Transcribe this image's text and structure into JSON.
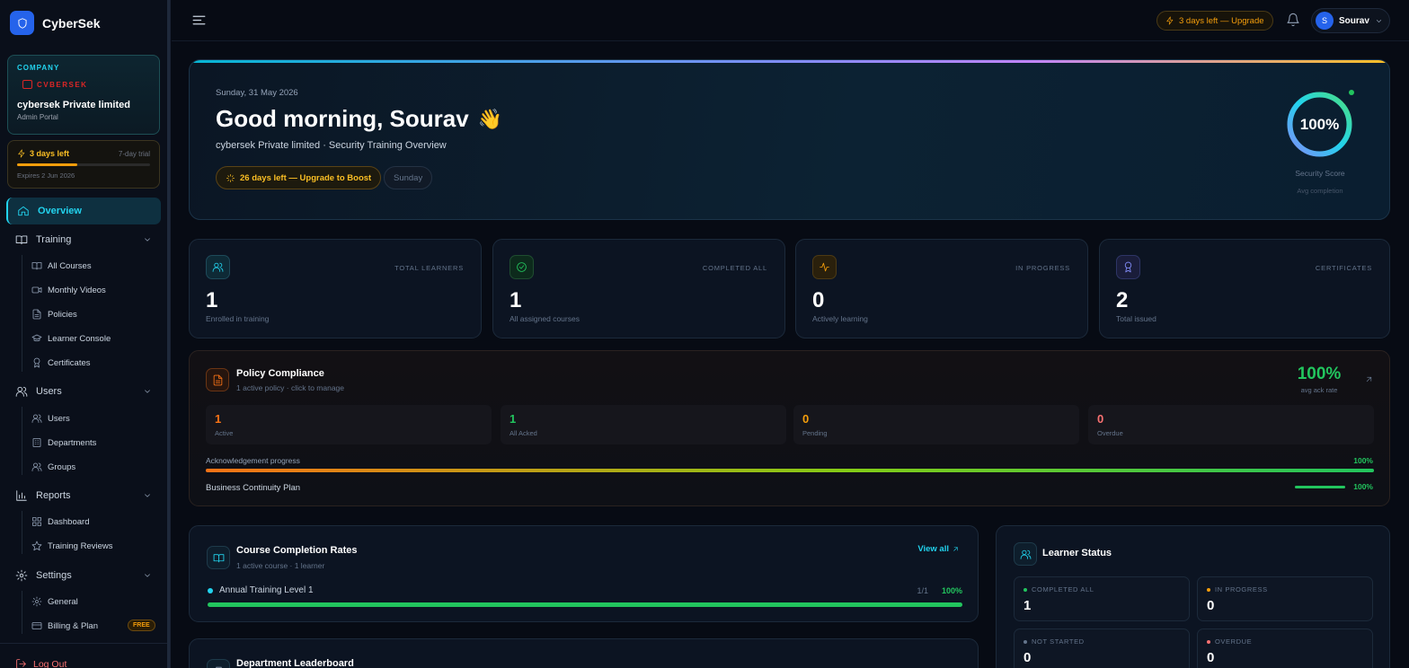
{
  "brand": {
    "name": "CyberSek"
  },
  "company": {
    "tag": "COMPANY",
    "logo_text": "CVBERSEK",
    "name": "cybersek Private limited",
    "role": "Admin Portal"
  },
  "trial": {
    "days_left": "3 days left",
    "type": "7-day trial",
    "progress": 0.45,
    "expires": "Expires 2 Jun 2026"
  },
  "nav": {
    "overview": "Overview",
    "training": {
      "label": "Training",
      "items": [
        "All Courses",
        "Monthly Videos",
        "Policies",
        "Learner Console",
        "Certificates"
      ]
    },
    "users": {
      "label": "Users",
      "items": [
        "Users",
        "Departments",
        "Groups"
      ]
    },
    "reports": {
      "label": "Reports",
      "items": [
        "Dashboard",
        "Training Reviews"
      ]
    },
    "settings": {
      "label": "Settings",
      "items": [
        "General",
        "Billing & Plan"
      ],
      "billing_badge": "FREE"
    },
    "logout": "Log Out"
  },
  "topbar": {
    "upgrade": "3 days left — Upgrade",
    "user_initial": "S",
    "user_name": "Sourav"
  },
  "hero": {
    "date": "Sunday, 31 May 2026",
    "greeting": "Good morning, Sourav",
    "subtitle": "cybersek Private limited · Security Training Overview",
    "boost": "26 days left — Upgrade to Boost",
    "day": "Sunday",
    "score": "100%",
    "score_value": 1.0,
    "score_label": "Security Score",
    "score_sub": "Avg completion"
  },
  "stats": [
    {
      "label": "TOTAL LEARNERS",
      "value": "1",
      "sub": "Enrolled in training",
      "icon": "users-icon",
      "color": "#22d3ee"
    },
    {
      "label": "COMPLETED ALL",
      "value": "1",
      "sub": "All assigned courses",
      "icon": "check-circle-icon",
      "color": "#22c55e"
    },
    {
      "label": "IN PROGRESS",
      "value": "0",
      "sub": "Actively learning",
      "icon": "activity-icon",
      "color": "#f59e0b"
    },
    {
      "label": "CERTIFICATES",
      "value": "2",
      "sub": "Total issued",
      "icon": "award-icon",
      "color": "#818cf8"
    }
  ],
  "policy": {
    "title": "Policy Compliance",
    "subtitle": "1 active policy · click to manage",
    "rate": "100%",
    "rate_label": "avg ack rate",
    "stats": [
      {
        "value": "1",
        "label": "Active",
        "color": "#f97316"
      },
      {
        "value": "1",
        "label": "All Acked",
        "color": "#22c55e"
      },
      {
        "value": "0",
        "label": "Pending",
        "color": "#f59e0b"
      },
      {
        "value": "0",
        "label": "Overdue",
        "color": "#f87171"
      }
    ],
    "ack_label": "Acknowledgement progress",
    "ack_pct": "100%",
    "ack_value": 1.0,
    "item_name": "Business Continuity Plan",
    "item_pct": "100%",
    "item_value": 1.0
  },
  "course": {
    "title": "Course Completion Rates",
    "subtitle": "1 active course · 1 learner",
    "view_all": "View all",
    "row_name": "Annual Training Level 1",
    "row_count": "1/1",
    "row_pct": "100%",
    "row_value": 1.0
  },
  "dept": {
    "title": "Department Leaderboard"
  },
  "learner": {
    "title": "Learner Status",
    "stats": [
      {
        "label": "COMPLETED ALL",
        "value": "1",
        "color": "#22c55e"
      },
      {
        "label": "IN PROGRESS",
        "value": "0",
        "color": "#f59e0b"
      },
      {
        "label": "NOT STARTED",
        "value": "0",
        "color": "#64748b"
      },
      {
        "label": "OVERDUE",
        "value": "0",
        "color": "#f87171"
      }
    ]
  }
}
